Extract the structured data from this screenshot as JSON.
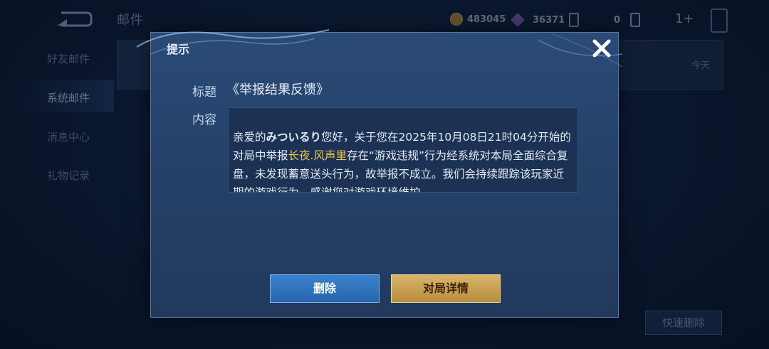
{
  "header": {
    "title": "邮件",
    "coins": "483045",
    "gems": "36371",
    "cards": "0",
    "plus_label": "1+"
  },
  "sidebar": {
    "items": [
      {
        "label": "好友邮件"
      },
      {
        "label": "系统邮件"
      },
      {
        "label": "消息中心"
      },
      {
        "label": "礼物记录"
      }
    ],
    "active_index": 1
  },
  "mail_list": {
    "rows": [
      {
        "date": "今天"
      }
    ]
  },
  "quick_delete_label": "快速删除",
  "dialog": {
    "title": "提示",
    "subject_label": "标题",
    "subject_value": "《举报结果反馈》",
    "content_label": "内容",
    "content": {
      "part1": "亲爱的",
      "player": "みついるり",
      "part2": "您好，关于您在2025年10月08日21时04分开始的对局中举报",
      "reported": "长夜.风声里",
      "part3": "存在“游戏违规”行为经系统对本局全面综合复盘，未发现蓄意送头行为，故举报不成立。我们会持续跟踪该玩家近期的游戏行为，感谢您对游戏环境维护"
    },
    "delete_button": "删除",
    "detail_button": "对局详情",
    "highlight_color": "#f0c54a"
  }
}
